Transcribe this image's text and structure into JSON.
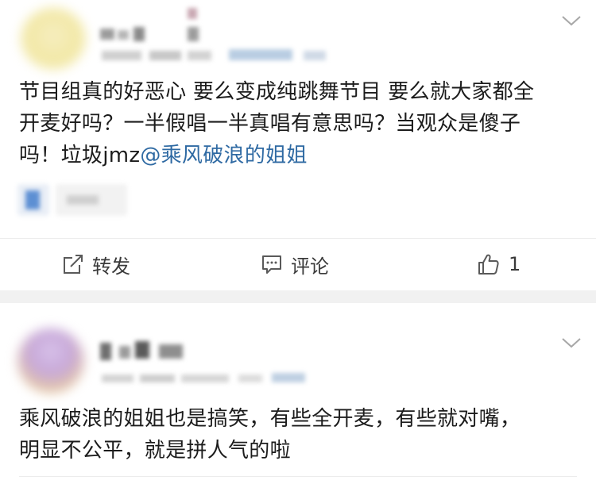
{
  "posts": [
    {
      "text_lines": [
        "节目组真的好恶心 要么变成纯跳舞节目 要么就大家都全",
        "开麦好吗？一半假唱一半真唱有意思吗？当观众是傻子",
        "吗！垃圾jmz"
      ],
      "mention": "@乘风破浪的姐姐",
      "actions": {
        "repost_label": "转发",
        "comment_label": "评论",
        "like_count": "1"
      }
    },
    {
      "text_lines": [
        "乘风破浪的姐姐也是搞笑，有些全开麦，有些就对嘴，",
        "明显不公平，就是拼人气的啦"
      ]
    }
  ],
  "icons": {
    "repost": "repost-icon",
    "comment": "comment-icon",
    "like": "thumbs-up-icon",
    "more": "chevron-down-icon"
  },
  "colors": {
    "text": "#1c1c1c",
    "mention": "#2f6aa3",
    "divider": "#f1f1f1"
  }
}
